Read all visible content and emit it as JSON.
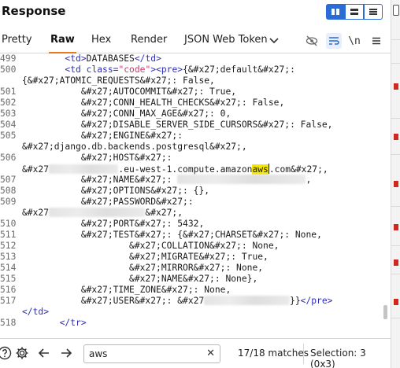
{
  "title": "Response",
  "layout_buttons": [
    {
      "icon": "columns-layout-icon",
      "active": true
    },
    {
      "icon": "rows-layout-icon",
      "active": false
    },
    {
      "icon": "single-panel-icon",
      "active": false
    }
  ],
  "tabs": [
    {
      "label": "Pretty",
      "active": false
    },
    {
      "label": "Raw",
      "active": true
    },
    {
      "label": "Hex",
      "active": false
    },
    {
      "label": "Render",
      "active": false
    },
    {
      "label": "JSON Web Token",
      "active": false
    }
  ],
  "toolbar_icons": {
    "dropdown": "chevron-down-icon",
    "hide": "eye-off-icon",
    "wrap": "word-wrap-icon",
    "newline": "\\n",
    "menu": "hamburger-menu-icon"
  },
  "code_lines": [
    {
      "num": "499",
      "parts": [
        [
          "",
          "        "
        ],
        [
          "tag",
          "<td>"
        ],
        [
          "",
          "DATABASES"
        ],
        [
          "tag",
          "</td>"
        ]
      ]
    },
    {
      "num": "500",
      "parts": [
        [
          "",
          "        "
        ],
        [
          "tag",
          "<td "
        ],
        [
          "attr",
          "class="
        ],
        [
          "str",
          "\"code\""
        ],
        [
          "tag",
          "><pre>"
        ],
        [
          "",
          "{&#x27;default&#x27;:"
        ]
      ]
    },
    {
      "num": "",
      "parts": [
        [
          "",
          "{&#x27;ATOMIC_REQUESTS&#x27;: False,"
        ]
      ]
    },
    {
      "num": "501",
      "parts": [
        [
          "",
          "           &#x27;AUTOCOMMIT&#x27;: True,"
        ]
      ]
    },
    {
      "num": "502",
      "parts": [
        [
          "",
          "           &#x27;CONN_HEALTH_CHECKS&#x27;: False,"
        ]
      ]
    },
    {
      "num": "503",
      "parts": [
        [
          "",
          "           &#x27;CONN_MAX_AGE&#x27;: 0,"
        ]
      ]
    },
    {
      "num": "504",
      "parts": [
        [
          "",
          "           &#x27;DISABLE_SERVER_SIDE_CURSORS&#x27;: False,"
        ]
      ]
    },
    {
      "num": "505",
      "parts": [
        [
          "",
          "           &#x27;ENGINE&#x27;:"
        ]
      ]
    },
    {
      "num": "",
      "parts": [
        [
          "",
          "&#x27;django.db.backends.postgresql&#x27;,"
        ]
      ]
    },
    {
      "num": "506",
      "parts": [
        [
          "",
          "           &#x27;HOST&#x27;:"
        ]
      ]
    },
    {
      "num": "",
      "parts": [
        [
          "",
          "&#x27"
        ],
        [
          "blur",
          "13"
        ],
        [
          ".eu-west-1.compute.amazon",
          ".eu-west-1.compute.amazon"
        ],
        [
          "hl",
          "aws"
        ],
        [
          "caret",
          ""
        ],
        [
          "",
          ".com&#x27;,"
        ]
      ]
    },
    {
      "num": "507",
      "parts": [
        [
          "",
          "           &#x27;NAME&#x27;: "
        ],
        [
          "blur",
          "24"
        ],
        [
          "",
          ","
        ]
      ]
    },
    {
      "num": "508",
      "parts": [
        [
          "",
          "           &#x27;OPTIONS&#x27;: {},"
        ]
      ]
    },
    {
      "num": "509",
      "parts": [
        [
          "",
          "           &#x27;PASSWORD&#x27;:"
        ]
      ]
    },
    {
      "num": "",
      "parts": [
        [
          "",
          "&#x27"
        ],
        [
          "blur",
          "18"
        ],
        [
          "",
          "&#x27;,"
        ]
      ]
    },
    {
      "num": "510",
      "parts": [
        [
          "",
          "           &#x27;PORT&#x27;: 5432,"
        ]
      ]
    },
    {
      "num": "511",
      "parts": [
        [
          "",
          "           &#x27;TEST&#x27;: {&#x27;CHARSET&#x27;: None,"
        ]
      ]
    },
    {
      "num": "512",
      "parts": [
        [
          "",
          "                    &#x27;COLLATION&#x27;: None,"
        ]
      ]
    },
    {
      "num": "513",
      "parts": [
        [
          "",
          "                    &#x27;MIGRATE&#x27;: True,"
        ]
      ]
    },
    {
      "num": "514",
      "parts": [
        [
          "",
          "                    &#x27;MIRROR&#x27;: None,"
        ]
      ]
    },
    {
      "num": "515",
      "parts": [
        [
          "",
          "                    &#x27;NAME&#x27;: None},"
        ]
      ]
    },
    {
      "num": "516",
      "parts": [
        [
          "",
          "           &#x27;TIME_ZONE&#x27;: None,"
        ]
      ]
    },
    {
      "num": "517",
      "parts": [
        [
          "",
          "           &#x27;USER&#x27;: &#x27"
        ],
        [
          "blur",
          "16"
        ],
        [
          "",
          "}}"
        ],
        [
          "tag",
          "</pre>"
        ]
      ]
    },
    {
      "num": "",
      "parts": [
        [
          "tag",
          "</td>"
        ]
      ]
    },
    {
      "num": "518",
      "parts": [
        [
          "",
          "       "
        ],
        [
          "tag",
          "</tr>"
        ]
      ]
    }
  ],
  "bottom": {
    "help_icon": "help-icon",
    "settings_icon": "gear-icon",
    "back_icon": "arrow-left-icon",
    "forward_icon": "arrow-right-icon",
    "search_value": "aws",
    "clear_icon": "close-icon",
    "matches": "17/18 matches",
    "selection": "Selection: 3 (0x3)"
  }
}
